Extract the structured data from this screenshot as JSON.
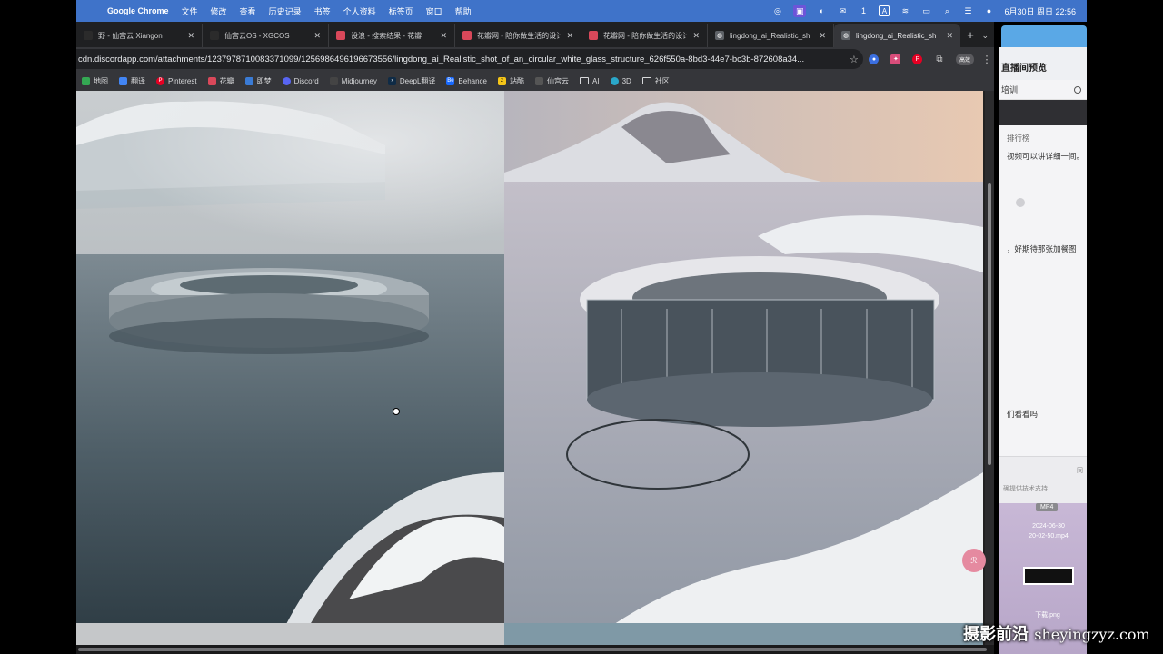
{
  "menubar": {
    "app_name": "Google Chrome",
    "menus": [
      "文件",
      "修改",
      "查看",
      "历史记录",
      "书签",
      "个人资料",
      "标签页",
      "窗口",
      "帮助"
    ],
    "wechat_count": "1",
    "input_method": "A",
    "datetime": "6月30日 周日 22:56"
  },
  "tabs": [
    {
      "title": "野 - 仙宫云 Xiangon",
      "icon": "page-icon",
      "color": "#2b2b2b",
      "active": false
    },
    {
      "title": "仙宫云OS - XGCOS",
      "icon": "xgcos-icon",
      "color": "#2b2b2b",
      "active": false
    },
    {
      "title": "设浪 - 搜索结果 - 花瓣",
      "icon": "huaban-icon",
      "color": "#d9485a",
      "active": false
    },
    {
      "title": "花瓣网 - 陪你做生活的设计",
      "icon": "huaban-icon",
      "color": "#d9485a",
      "active": false
    },
    {
      "title": "花瓣网 - 陪你做生活的设计",
      "icon": "huaban-icon",
      "color": "#d9485a",
      "active": false
    },
    {
      "title": "lingdong_ai_Realistic_sh",
      "icon": "globe-icon",
      "color": "#5f6368",
      "active": false
    },
    {
      "title": "lingdong_ai_Realistic_sh",
      "icon": "globe-icon",
      "color": "#5f6368",
      "active": true
    }
  ],
  "address": {
    "url": "cdn.discordapp.com/attachments/1237978710083371099/1256986496196673556/lingdong_ai_Realistic_shot_of_an_circular_white_glass_structure_626f550a-8bd3-44e7-bc3b-872608a34..."
  },
  "profile_label": "高效",
  "bookmarks": [
    {
      "label": "地图",
      "icon": "maps-icon",
      "color": "#34a853"
    },
    {
      "label": "翻译",
      "icon": "translate-icon",
      "color": "#4285f4"
    },
    {
      "label": "Pinterest",
      "icon": "pinterest-icon",
      "color": "#e60023"
    },
    {
      "label": "花瓣",
      "icon": "huaban-icon",
      "color": "#d9485a"
    },
    {
      "label": "即梦",
      "icon": "jimeng-icon",
      "color": "#3a7bd5"
    },
    {
      "label": "Discord",
      "icon": "discord-icon",
      "color": "#5865f2"
    },
    {
      "label": "Midjourney",
      "icon": "midjourney-icon",
      "color": "#444444"
    },
    {
      "label": "DeepL翻译",
      "icon": "deepl-icon",
      "color": "#0f2b46"
    },
    {
      "label": "Behance",
      "icon": "behance-icon",
      "color": "#1769ff"
    },
    {
      "label": "站酷",
      "icon": "zcool-icon",
      "color": "#f5c518"
    },
    {
      "label": "仙宫云",
      "icon": "xgc-icon",
      "color": "#555555"
    },
    {
      "label": "AI",
      "icon": "folder-icon",
      "color": ""
    },
    {
      "label": "3D",
      "icon": "3d-icon",
      "color": "#2aa7c9"
    },
    {
      "label": "社区",
      "icon": "folder-icon",
      "color": ""
    }
  ],
  "right_panel": {
    "title": "直播间预览",
    "search_text": "培训",
    "rank_label": "排行榜",
    "msg1": "视频可以讲详细一间。",
    "msg2": "，好期待那张加餐图",
    "msg3": "们看看吗",
    "footer_refresh": "同",
    "footer_hint": "确提供技术支持"
  },
  "desktop": {
    "badge": "MP4",
    "video_date": "2024-06-30",
    "video_name": "20-02-50.mp4",
    "png_name": "下载.png"
  },
  "watermark": {
    "cn": "摄影前沿",
    "latin": "sheyingzyz.com"
  },
  "fab_label": "ℛ"
}
